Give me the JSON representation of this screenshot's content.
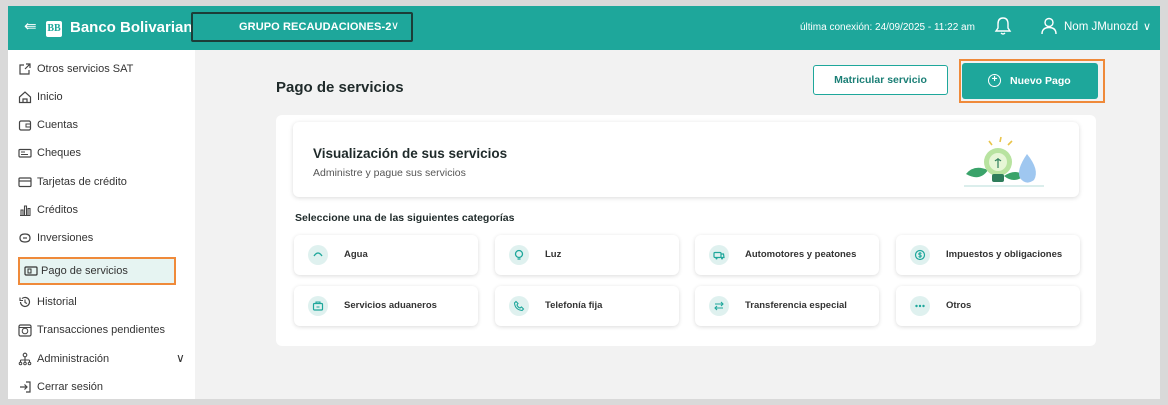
{
  "header": {
    "back_icon": "collapse-menu-icon",
    "logo_letters": "BB",
    "brand": "Banco Bolivariano",
    "group_selector": "GRUPO RECAUDACIONES-2",
    "last_connection": "última conexión: 24/09/2025 - 11:22 am",
    "user_name": "Nom JMunozd",
    "accent_color": "#1ea79b"
  },
  "sidebar": {
    "items": [
      {
        "label": "Otros servicios SAT",
        "icon": "external-link-icon"
      },
      {
        "label": "Inicio",
        "icon": "home-icon"
      },
      {
        "label": "Cuentas",
        "icon": "wallet-icon"
      },
      {
        "label": "Cheques",
        "icon": "cheque-icon"
      },
      {
        "label": "Tarjetas de crédito",
        "icon": "credit-card-icon"
      },
      {
        "label": "Créditos",
        "icon": "chart-icon"
      },
      {
        "label": "Inversiones",
        "icon": "investment-icon"
      },
      {
        "label": "Pago de servicios",
        "icon": "service-payment-icon"
      },
      {
        "label": "Historial",
        "icon": "history-icon"
      },
      {
        "label": "Transacciones pendientes",
        "icon": "pending-icon"
      },
      {
        "label": "Administración",
        "icon": "admin-icon"
      },
      {
        "label": "Cerrar sesión",
        "icon": "logout-icon"
      }
    ],
    "active_label": "Pago de servicios"
  },
  "main": {
    "title": "Pago de servicios",
    "matricular_label": "Matricular servicio",
    "nuevo_pago_label": "Nuevo Pago",
    "banner_title": "Visualización de sus servicios",
    "banner_subtitle": "Administre y pague sus servicios",
    "categories_heading": "Seleccione una de las siguientes categorías",
    "categories": [
      {
        "label": "Agua",
        "icon": "water-icon"
      },
      {
        "label": "Luz",
        "icon": "lightbulb-icon"
      },
      {
        "label": "Automotores y peatones",
        "icon": "car-icon"
      },
      {
        "label": "Impuestos y obligaciones",
        "icon": "coin-icon"
      },
      {
        "label": "Servicios aduaneros",
        "icon": "customs-icon"
      },
      {
        "label": "Telefonía fija",
        "icon": "phone-icon"
      },
      {
        "label": "Transferencia especial",
        "icon": "transfer-icon"
      },
      {
        "label": "Otros",
        "icon": "more-icon"
      }
    ]
  }
}
